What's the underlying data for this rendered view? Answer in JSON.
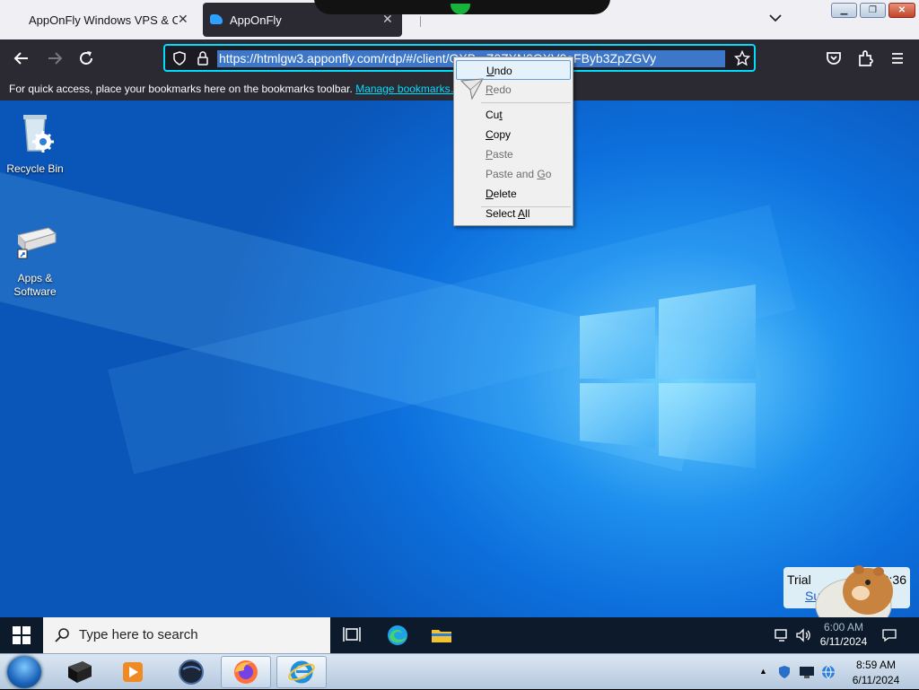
{
  "browser": {
    "tabs": [
      {
        "title": "AppOnFly Windows VPS & Clo",
        "active": false
      },
      {
        "title": "AppOnFly",
        "active": true
      }
    ],
    "close_glyph": "✕",
    "window_buttons": {
      "minimize": "▁",
      "maximize": "❐",
      "close": "✕"
    },
    "url": "https://htmlgw3.apponfly.com/rdp/#/client/OXB...Z0ZXN0QXV0aFByb3ZpZGVy",
    "bookmarks_message": "For quick access, place your bookmarks here on the bookmarks toolbar.",
    "bookmarks_link": "Manage bookmarks…"
  },
  "context_menu": {
    "items": [
      {
        "label_pre": "",
        "accel": "U",
        "label_post": "ndo",
        "enabled": true
      },
      {
        "label_pre": "",
        "accel": "R",
        "label_post": "edo",
        "enabled": false
      },
      {
        "label_pre": "Cu",
        "accel": "t",
        "label_post": "",
        "enabled": true
      },
      {
        "label_pre": "",
        "accel": "C",
        "label_post": "opy",
        "enabled": true
      },
      {
        "label_pre": "",
        "accel": "P",
        "label_post": "aste",
        "enabled": false
      },
      {
        "label_pre": "Paste and ",
        "accel": "G",
        "label_post": "o",
        "enabled": false
      },
      {
        "label_pre": "",
        "accel": "D",
        "label_post": "elete",
        "enabled": true
      },
      {
        "label_pre": "Select ",
        "accel": "A",
        "label_post": "ll",
        "enabled": true
      }
    ]
  },
  "desktop": {
    "icons": [
      {
        "label": "Recycle Bin",
        "icon": "recycle-bin-icon"
      },
      {
        "label": "Apps & Software",
        "icon": "apps-software-icon"
      }
    ],
    "trial": {
      "label": "Trial",
      "link": "Su",
      "time": "2:36"
    }
  },
  "taskbar10": {
    "search_placeholder": "Type here to search",
    "time": "6:00 AM",
    "date": "6/11/2024"
  },
  "taskbar7": {
    "time": "8:59 AM",
    "date": "6/11/2024"
  },
  "colors": {
    "firefox_dark": "#2b2a33",
    "url_focus": "#00ddff",
    "desktop_blue": "#0d6fdc"
  }
}
